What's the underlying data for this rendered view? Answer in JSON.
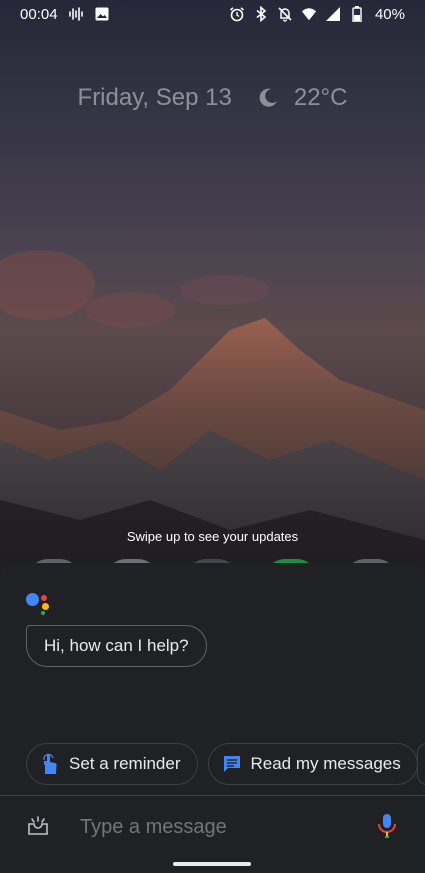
{
  "status_bar": {
    "time": "00:04",
    "battery": "40%",
    "icons": [
      "equalizer-icon",
      "image-icon",
      "alarm-icon",
      "bluetooth-icon",
      "notifications-off-icon",
      "wifi-icon",
      "signal-icon",
      "battery-icon"
    ]
  },
  "glance": {
    "date": "Friday, Sep 13",
    "weather_icon": "moon-icon",
    "temperature": "22°C"
  },
  "swipe_hint": "Swipe up to see your updates",
  "assistant": {
    "greeting": "Hi, how can I help?",
    "logo_colors": [
      "#4285f4",
      "#ea4335",
      "#fbbc04",
      "#34a853"
    ],
    "suggestions": [
      {
        "label": "Set a reminder",
        "icon": "reminder-hand-icon"
      },
      {
        "label": "Read my messages",
        "icon": "message-icon"
      }
    ],
    "input_placeholder": "Type a message"
  },
  "colors": {
    "accent_blue": "#4285f4",
    "sheet_bg": "#202124"
  }
}
